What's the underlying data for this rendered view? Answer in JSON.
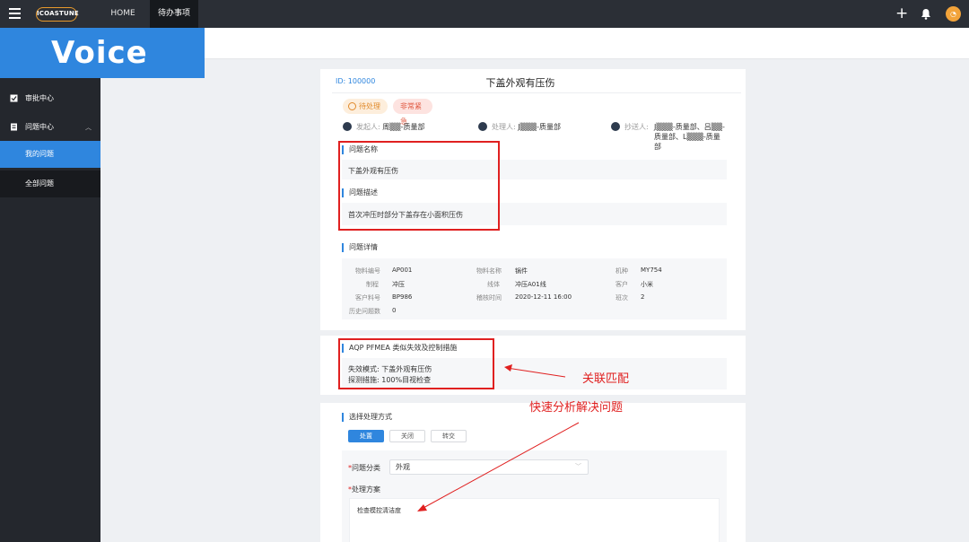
{
  "topbar": {
    "logo": "ICOASTUNE",
    "nav": [
      "HOME",
      "待办事项"
    ],
    "avatar": "◔"
  },
  "banner": {
    "text": "Voice"
  },
  "sidebar": {
    "items": [
      {
        "label": "审批中心",
        "icon": "approval-icon"
      },
      {
        "label": "问题中心",
        "icon": "issue-icon",
        "expanded": true
      }
    ],
    "sub_items": [
      {
        "label": "我的问题",
        "active": true
      },
      {
        "label": "全部问题",
        "active": false
      }
    ]
  },
  "issue": {
    "id": "ID: 100000",
    "title": "下盖外观有压伤",
    "tags": [
      "待处理",
      "非常紧急"
    ],
    "initiator_label": "发起人:",
    "initiator_value": "周▒▒-质量部",
    "handler_label": "处理人:",
    "handler_value": "J▒▒▒-质量部",
    "cc_label": "抄送人:",
    "cc_line1": "J▒▒▒-质量部、吕▒▒-",
    "cc_line2": "质量部、L▒▒▒-质量部"
  },
  "problem_name": {
    "label": "问题名称",
    "value": "下盖外观有压伤"
  },
  "problem_desc": {
    "label": "问题描述",
    "value": "首次冲压时部分下盖存在小面积压伤"
  },
  "details": {
    "label": "问题详情",
    "rows": [
      [
        {
          "k": "物料编号",
          "v": "AP001"
        },
        {
          "k": "物料名称",
          "v": "锅件"
        },
        {
          "k": "机种",
          "v": "MY754"
        }
      ],
      [
        {
          "k": "制程",
          "v": "冲压"
        },
        {
          "k": "线体",
          "v": "冲压A01线"
        },
        {
          "k": "客户",
          "v": "小米"
        }
      ],
      [
        {
          "k": "客户料号",
          "v": "BP986"
        },
        {
          "k": "稽核时间",
          "v": "2020-12-11 16:00"
        },
        {
          "k": "班次",
          "v": "2"
        }
      ],
      [
        {
          "k": "历史问题数",
          "v": "0"
        }
      ]
    ]
  },
  "pfmea": {
    "label": "AQP PFMEA 类似失效及控制措施",
    "failure_mode": "失效模式: 下盖外观有压伤",
    "detection": "探测措施: 100%目视检查"
  },
  "handling": {
    "label": "选择处理方式",
    "buttons": [
      "处置",
      "关闭",
      "转交"
    ],
    "category_label": "问题分类",
    "category_value": "外观",
    "plan_label": "处理方案",
    "plan_value": "检查模控清洁度"
  },
  "annotations": {
    "match": "关联匹配",
    "quick": "快速分析解决问题"
  },
  "colors": {
    "accent": "#2f86de",
    "highlight": "#e02020",
    "topbar": "#2b2f36",
    "sidebar": "#24272d"
  }
}
